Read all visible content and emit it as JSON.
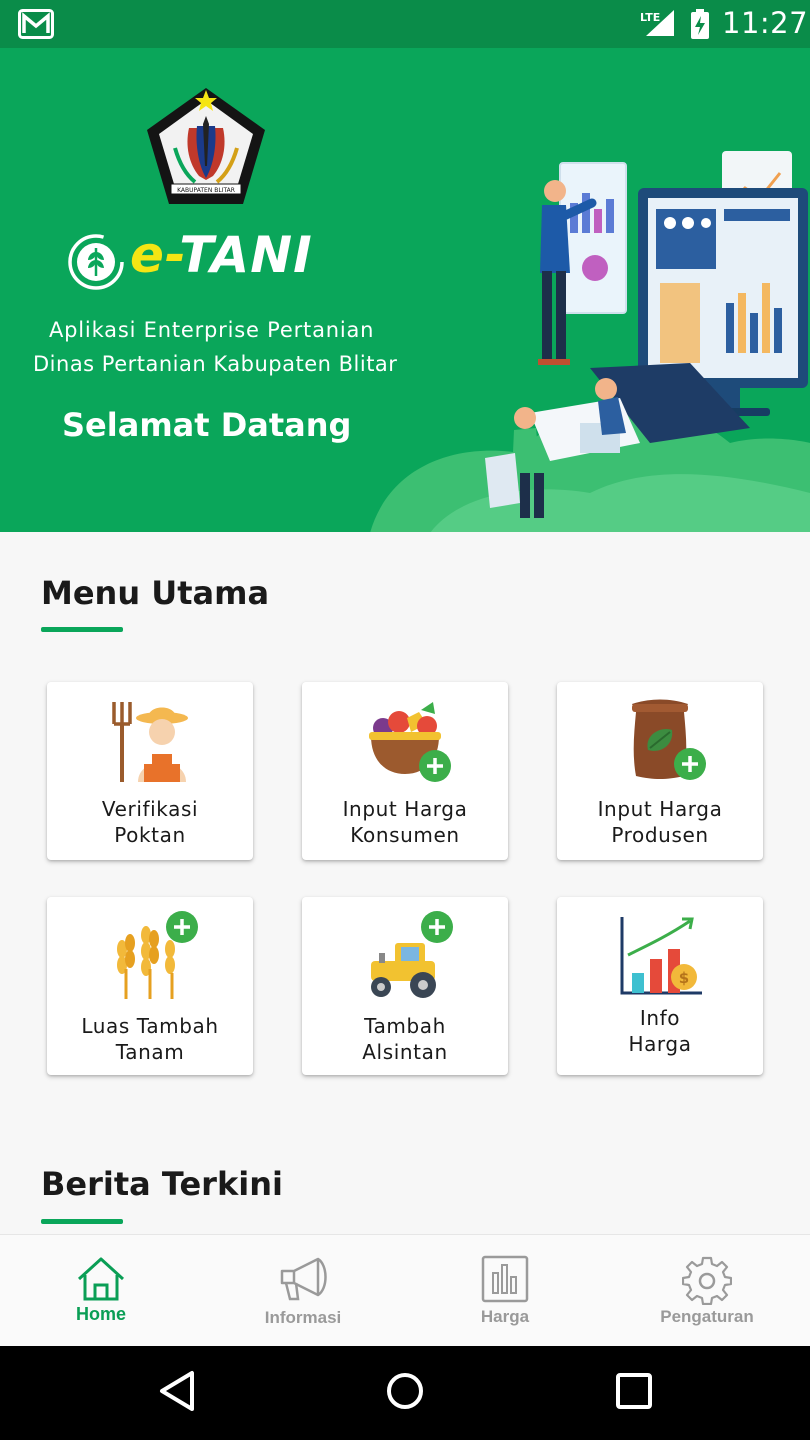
{
  "status_bar": {
    "time": "11:27",
    "network": "LTE",
    "icons": [
      "gmail-icon",
      "lte-signal-icon",
      "battery-charging-icon"
    ]
  },
  "hero": {
    "app_name_prefix": "e-",
    "app_name": "TANI",
    "subtitle_line1": "Aplikasi Enterprise Pertanian",
    "subtitle_line2": "Dinas Pertanian Kabupaten Blitar",
    "welcome": "Selamat Datang",
    "crest_caption": "KABUPATEN BLITAR",
    "colors": {
      "primary": "#0aa65a",
      "brand_yellow": "#f5e514"
    }
  },
  "main_menu": {
    "title": "Menu Utama",
    "tiles": [
      {
        "line1": "Verifikasi",
        "line2": "Poktan",
        "icon": "farmer-icon"
      },
      {
        "line1": "Input Harga",
        "line2": "Konsumen",
        "icon": "fruit-basket-add-icon"
      },
      {
        "line1": "Input Harga",
        "line2": "Produsen",
        "icon": "seed-sack-add-icon"
      },
      {
        "line1": "Luas Tambah",
        "line2": "Tanam",
        "icon": "wheat-add-icon"
      },
      {
        "line1": "Tambah",
        "line2": "Alsintan",
        "icon": "tractor-add-icon"
      },
      {
        "line1": "Info",
        "line2": "Harga",
        "icon": "price-chart-icon"
      }
    ]
  },
  "news": {
    "title": "Berita Terkini"
  },
  "bottom_nav": {
    "items": [
      {
        "label": "Home",
        "icon": "home-icon",
        "active": true
      },
      {
        "label": "Informasi",
        "icon": "megaphone-icon",
        "active": false
      },
      {
        "label": "Harga",
        "icon": "bar-chart-icon",
        "active": false
      },
      {
        "label": "Pengaturan",
        "icon": "gear-icon",
        "active": false
      }
    ]
  },
  "system_nav": {
    "buttons": [
      "back-icon",
      "home-circle-icon",
      "recents-icon"
    ]
  }
}
